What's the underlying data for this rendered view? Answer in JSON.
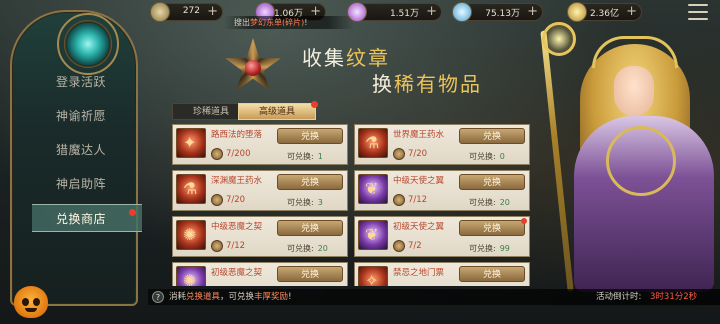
{
  "resources": [
    {
      "icon": "compass-coin-icon",
      "value": "272"
    },
    {
      "icon": "purple-orb-icon",
      "value": "1.06万"
    },
    {
      "icon": "amethyst-icon",
      "value": "1.51万"
    },
    {
      "icon": "diamond-icon",
      "value": "75.13万"
    },
    {
      "icon": "gold-coin-icon",
      "value": "2.36亿"
    }
  ],
  "marquee": {
    "prefix": "搜出",
    "highlight": "梦幻东单(碎片)",
    "suffix": "!"
  },
  "nav": {
    "items": [
      {
        "label": "登录活跃",
        "active": false
      },
      {
        "label": "神谕祈愿",
        "active": false
      },
      {
        "label": "猎魔达人",
        "active": false
      },
      {
        "label": "神启助阵",
        "active": false
      },
      {
        "label": "兑换商店",
        "active": true
      }
    ]
  },
  "header": {
    "line1_a": "收集",
    "line1_b": "纹章",
    "line2_a": "换",
    "line2_b": "稀有物品"
  },
  "tabs": [
    {
      "label": "珍稀道具",
      "active": false
    },
    {
      "label": "高级道具",
      "active": true
    }
  ],
  "items": [
    {
      "name": "路西法的堕落",
      "cost": "7/200",
      "button": "兑换",
      "can_label": "可兑换:",
      "can_value": "1",
      "icon_style": "red",
      "glyph": "✦"
    },
    {
      "name": "世界魔王药水",
      "cost": "7/20",
      "button": "兑换",
      "can_label": "可兑换:",
      "can_value": "0",
      "icon_style": "red",
      "glyph": "⚗"
    },
    {
      "name": "深渊魔王药水",
      "cost": "7/20",
      "button": "兑换",
      "can_label": "可兑换:",
      "can_value": "3",
      "icon_style": "red",
      "glyph": "⚗"
    },
    {
      "name": "中级天使之翼",
      "cost": "7/12",
      "button": "兑换",
      "can_label": "可兑换:",
      "can_value": "20",
      "icon_style": "purple",
      "glyph": "❦"
    },
    {
      "name": "中级恶魔之契",
      "cost": "7/12",
      "button": "兑换",
      "can_label": "可兑换:",
      "can_value": "20",
      "icon_style": "red",
      "glyph": "✺"
    },
    {
      "name": "初级天使之翼",
      "cost": "7/2",
      "button": "兑换",
      "can_label": "可兑换:",
      "can_value": "99",
      "icon_style": "purple",
      "glyph": "❦"
    },
    {
      "name": "初级恶魔之契",
      "cost": "",
      "button": "兑换",
      "can_label": "",
      "can_value": "",
      "icon_style": "purple",
      "glyph": "✺"
    },
    {
      "name": "禁忌之地门票",
      "cost": "",
      "button": "兑换",
      "can_label": "",
      "can_value": "",
      "icon_style": "red",
      "glyph": "✧"
    }
  ],
  "footer": {
    "help": "?",
    "tip_a": "消耗",
    "tip_hl1": "兑换道具",
    "tip_b": "，可兑换",
    "tip_hl2": "丰厚奖励",
    "tip_c": "!",
    "countdown_label": "活动倒计时:",
    "countdown": "3时31分2秒"
  },
  "colors": {
    "accent_gold": "#ecc35a",
    "warning_red": "#e3412b",
    "item_name": "#b8452a"
  }
}
